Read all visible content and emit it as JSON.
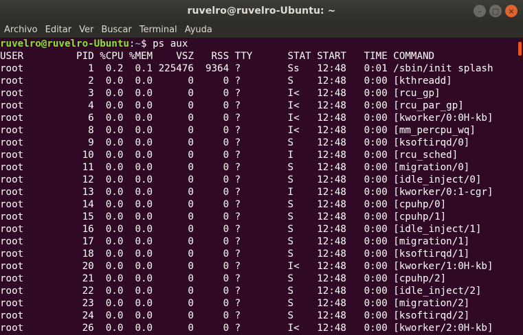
{
  "window": {
    "title": "ruvelro@ruvelro-Ubuntu: ~",
    "buttons": {
      "minimize": "–",
      "maximize": "□",
      "close": "×"
    }
  },
  "menubar": [
    "Archivo",
    "Editar",
    "Ver",
    "Buscar",
    "Terminal",
    "Ayuda"
  ],
  "terminal": {
    "prompt_user": "ruvelro@ruvelro-Ubuntu",
    "prompt_sep": ":",
    "prompt_path": "~",
    "prompt_tail": "$ ",
    "command": "ps aux",
    "header": "USER         PID %CPU %MEM    VSZ   RSS TTY      STAT START   TIME COMMAND",
    "rows": [
      "root           1  0.2  0.1 225476  9364 ?        Ss   12:48   0:01 /sbin/init splash",
      "root           2  0.0  0.0      0     0 ?        S    12:48   0:00 [kthreadd]",
      "root           3  0.0  0.0      0     0 ?        I<   12:48   0:00 [rcu_gp]",
      "root           4  0.0  0.0      0     0 ?        I<   12:48   0:00 [rcu_par_gp]",
      "root           6  0.0  0.0      0     0 ?        I<   12:48   0:00 [kworker/0:0H-kb]",
      "root           8  0.0  0.0      0     0 ?        I<   12:48   0:00 [mm_percpu_wq]",
      "root           9  0.0  0.0      0     0 ?        S    12:48   0:00 [ksoftirqd/0]",
      "root          10  0.0  0.0      0     0 ?        I    12:48   0:00 [rcu_sched]",
      "root          11  0.0  0.0      0     0 ?        S    12:48   0:00 [migration/0]",
      "root          12  0.0  0.0      0     0 ?        S    12:48   0:00 [idle_inject/0]",
      "root          13  0.0  0.0      0     0 ?        I    12:48   0:00 [kworker/0:1-cgr]",
      "root          14  0.0  0.0      0     0 ?        S    12:48   0:00 [cpuhp/0]",
      "root          15  0.0  0.0      0     0 ?        S    12:48   0:00 [cpuhp/1]",
      "root          16  0.0  0.0      0     0 ?        S    12:48   0:00 [idle_inject/1]",
      "root          17  0.0  0.0      0     0 ?        S    12:48   0:00 [migration/1]",
      "root          18  0.0  0.0      0     0 ?        S    12:48   0:00 [ksoftirqd/1]",
      "root          20  0.0  0.0      0     0 ?        I<   12:48   0:00 [kworker/1:0H-kb]",
      "root          21  0.0  0.0      0     0 ?        S    12:48   0:00 [cpuhp/2]",
      "root          22  0.0  0.0      0     0 ?        S    12:48   0:00 [idle_inject/2]",
      "root          23  0.0  0.0      0     0 ?        S    12:48   0:00 [migration/2]",
      "root          24  0.0  0.0      0     0 ?        S    12:48   0:00 [ksoftirqd/2]",
      "root          26  0.0  0.0      0     0 ?        I<   12:48   0:00 [kworker/2:0H-kb]"
    ]
  },
  "colors": {
    "background": "#300a24",
    "prompt_user": "#8ae234",
    "prompt_path": "#729fcf",
    "scroll_thumb": "#e95420"
  }
}
